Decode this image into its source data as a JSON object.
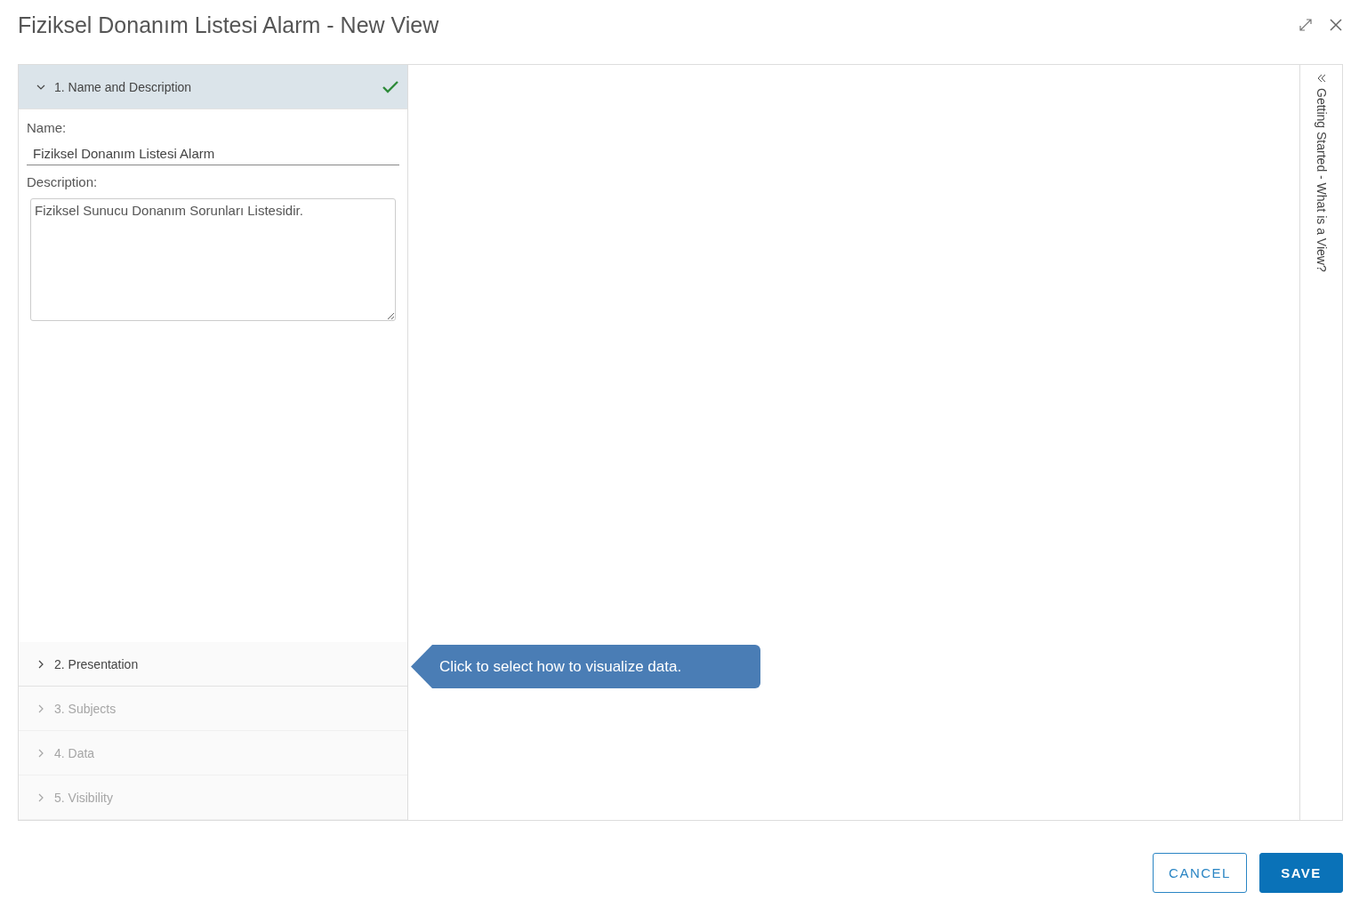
{
  "window": {
    "title": "Fiziksel Donanım Listesi Alarm - New View"
  },
  "steps": [
    {
      "label": "1. Name and Description",
      "expanded": true,
      "completed": true,
      "disabled": false
    },
    {
      "label": "2. Presentation",
      "expanded": false,
      "completed": false,
      "disabled": false
    },
    {
      "label": "3. Subjects",
      "expanded": false,
      "completed": false,
      "disabled": true
    },
    {
      "label": "4. Data",
      "expanded": false,
      "completed": false,
      "disabled": true
    },
    {
      "label": "5. Visibility",
      "expanded": false,
      "completed": false,
      "disabled": true
    }
  ],
  "form": {
    "name_label": "Name:",
    "name_value": "Fiziksel Donanım Listesi Alarm",
    "description_label": "Description:",
    "description_value": "Fiziksel Sunucu Donanım Sorunları Listesidir."
  },
  "tooltip": {
    "text": "Click to select how to visualize data."
  },
  "side_panel": {
    "title": "Getting Started - What is a View?"
  },
  "buttons": [
    {
      "label": "CANCEL",
      "kind": "secondary"
    },
    {
      "label": "SAVE",
      "kind": "primary"
    }
  ]
}
